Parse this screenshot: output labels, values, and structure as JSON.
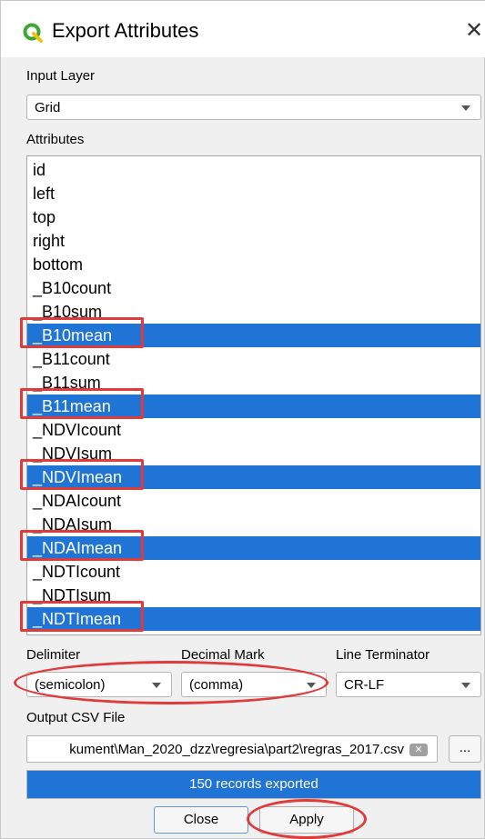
{
  "window": {
    "title": "Export Attributes",
    "close_glyph": "✕",
    "app_icon": "qgis-icon"
  },
  "input_layer": {
    "label": "Input Layer",
    "value": "Grid"
  },
  "attributes": {
    "label": "Attributes",
    "items": [
      {
        "label": "id",
        "selected": false
      },
      {
        "label": "left",
        "selected": false
      },
      {
        "label": "top",
        "selected": false
      },
      {
        "label": "right",
        "selected": false
      },
      {
        "label": "bottom",
        "selected": false
      },
      {
        "label": "_B10count",
        "selected": false
      },
      {
        "label": "_B10sum",
        "selected": false
      },
      {
        "label": "_B10mean",
        "selected": true
      },
      {
        "label": "_B11count",
        "selected": false
      },
      {
        "label": "_B11sum",
        "selected": false
      },
      {
        "label": "_B11mean",
        "selected": true
      },
      {
        "label": "_NDVIcount",
        "selected": false
      },
      {
        "label": "_NDVIsum",
        "selected": false
      },
      {
        "label": "_NDVImean",
        "selected": true
      },
      {
        "label": "_NDAIcount",
        "selected": false
      },
      {
        "label": "_NDAIsum",
        "selected": false
      },
      {
        "label": "_NDAImean",
        "selected": true
      },
      {
        "label": "_NDTIcount",
        "selected": false
      },
      {
        "label": "_NDTIsum",
        "selected": false
      },
      {
        "label": "_NDTImean",
        "selected": true
      }
    ]
  },
  "delimiter": {
    "label": "Delimiter",
    "value": "(semicolon)"
  },
  "decimal_mark": {
    "label": "Decimal Mark",
    "value": "(comma)"
  },
  "line_terminator": {
    "label": "Line Terminator",
    "value": "CR-LF"
  },
  "output": {
    "label": "Output CSV File",
    "value": "kument\\Man_2020_dzz\\regresia\\part2\\regras_2017.csv",
    "clear_glyph": "✕",
    "browse_label": "..."
  },
  "progress": {
    "text": "150 records exported",
    "fraction": 1.0
  },
  "buttons": {
    "close": "Close",
    "apply": "Apply"
  },
  "colors": {
    "selection": "#1f74d6",
    "annotation": "#e03a3a",
    "qgis_green": "#3fa535"
  }
}
